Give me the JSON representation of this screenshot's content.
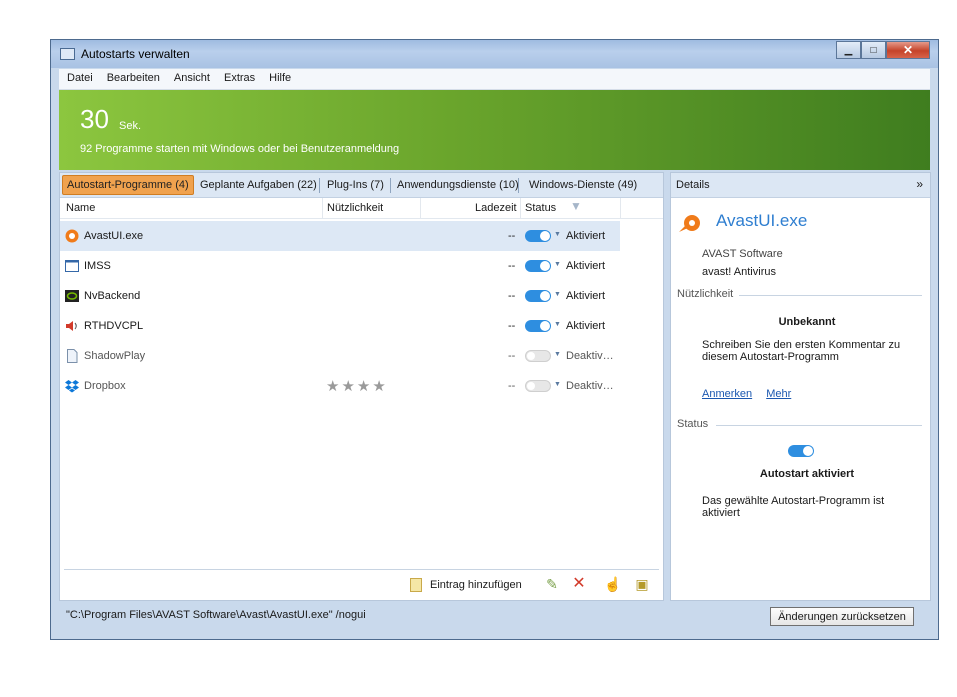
{
  "window": {
    "title": "Autostarts verwalten",
    "buttons": [
      "minimize",
      "maximize",
      "close"
    ]
  },
  "menu": [
    "Datei",
    "Bearbeiten",
    "Ansicht",
    "Extras",
    "Hilfe"
  ],
  "hero": {
    "value": "30",
    "unit": "Sek.",
    "subtitle": "92 Programme starten mit Windows oder bei Benutzeranmeldung"
  },
  "tabs": [
    {
      "label": "Autostart-Programme (4)",
      "active": true
    },
    {
      "label": "Geplante Aufgaben (22)"
    },
    {
      "label": "Plug-Ins (7)"
    },
    {
      "label": "Anwendungsdienste (10)"
    },
    {
      "label": "Windows-Dienste (49)"
    }
  ],
  "columns": {
    "name": "Name",
    "usefulness": "Nützlichkeit",
    "loadtime": "Ladezeit",
    "status": "Status"
  },
  "rows": [
    {
      "name": "AvastUI.exe",
      "load": "--",
      "status": "Aktiviert",
      "on": true,
      "icon": "avast-icon"
    },
    {
      "name": "IMSS",
      "load": "--",
      "status": "Aktiviert",
      "on": true,
      "icon": "window-icon"
    },
    {
      "name": "NvBackend",
      "load": "--",
      "status": "Aktiviert",
      "on": true,
      "icon": "nvidia-icon"
    },
    {
      "name": "RTHDVCPL",
      "load": "--",
      "status": "Aktiviert",
      "on": true,
      "icon": "speaker-icon"
    },
    {
      "name": "ShadowPlay",
      "load": "--",
      "status": "Deaktiv…",
      "on": false,
      "icon": "document-icon"
    },
    {
      "name": "Dropbox",
      "load": "--",
      "status": "Deaktiv…",
      "on": false,
      "icon": "dropbox-icon",
      "stars": "★★★★"
    }
  ],
  "bottom": {
    "add_label": "Eintrag hinzufügen"
  },
  "details": {
    "header": "Details",
    "collapse": "»",
    "app": "AvastUI.exe",
    "vendor": "AVAST Software",
    "product": "avast! Antivirus",
    "usefulness_section": "Nützlichkeit",
    "rating": "Unbekannt",
    "comment_prompt": "Schreiben Sie den ersten Kommentar zu diesem Autostart-Programm",
    "link_annotate": "Anmerken",
    "link_more": "Mehr",
    "status_section": "Status",
    "status_title": "Autostart aktiviert",
    "status_desc": "Das gewählte Autostart-Programm ist aktiviert"
  },
  "statusbar": {
    "path": "\"C:\\Program Files\\AVAST Software\\Avast\\AvastUI.exe\" /nogui",
    "reset": "Änderungen zurücksetzen"
  },
  "colors": {
    "accent": "#2e8ee0",
    "hero_start": "#8cc63f",
    "hero_end": "#3f7d1f",
    "active_tab": "#f0a24e"
  }
}
